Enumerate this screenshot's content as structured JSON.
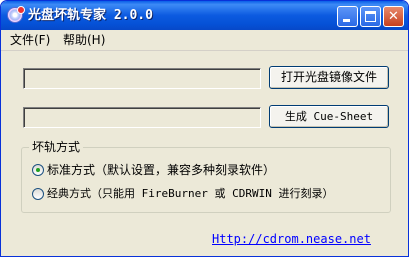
{
  "window": {
    "title": "光盘坏轨专家 2.0.0",
    "controls": {
      "minimize_icon": "minimize-icon",
      "maximize_icon": "maximize-icon",
      "close_icon": "close-icon",
      "close_glyph": "✕"
    }
  },
  "menu": {
    "file": "文件(F)",
    "help": "帮助(H)"
  },
  "main": {
    "image_path_value": "",
    "cue_path_value": "",
    "open_button": "打开光盘镜像文件",
    "generate_button": "生成 Cue-Sheet"
  },
  "mode_group": {
    "legend": "坏轨方式",
    "options": [
      {
        "label": "标准方式（默认设置，兼容多种刻录软件）",
        "selected": true
      },
      {
        "label": "经典方式（只能用 FireBurner 或 CDRWIN 进行刻录）",
        "selected": false
      }
    ]
  },
  "footer": {
    "link": "Http://cdrom.nease.net"
  },
  "colors": {
    "titlebar": "#0c5ae0",
    "window_bg": "#ece9d8",
    "link": "#0000ff",
    "radio_dot": "#21a121"
  }
}
